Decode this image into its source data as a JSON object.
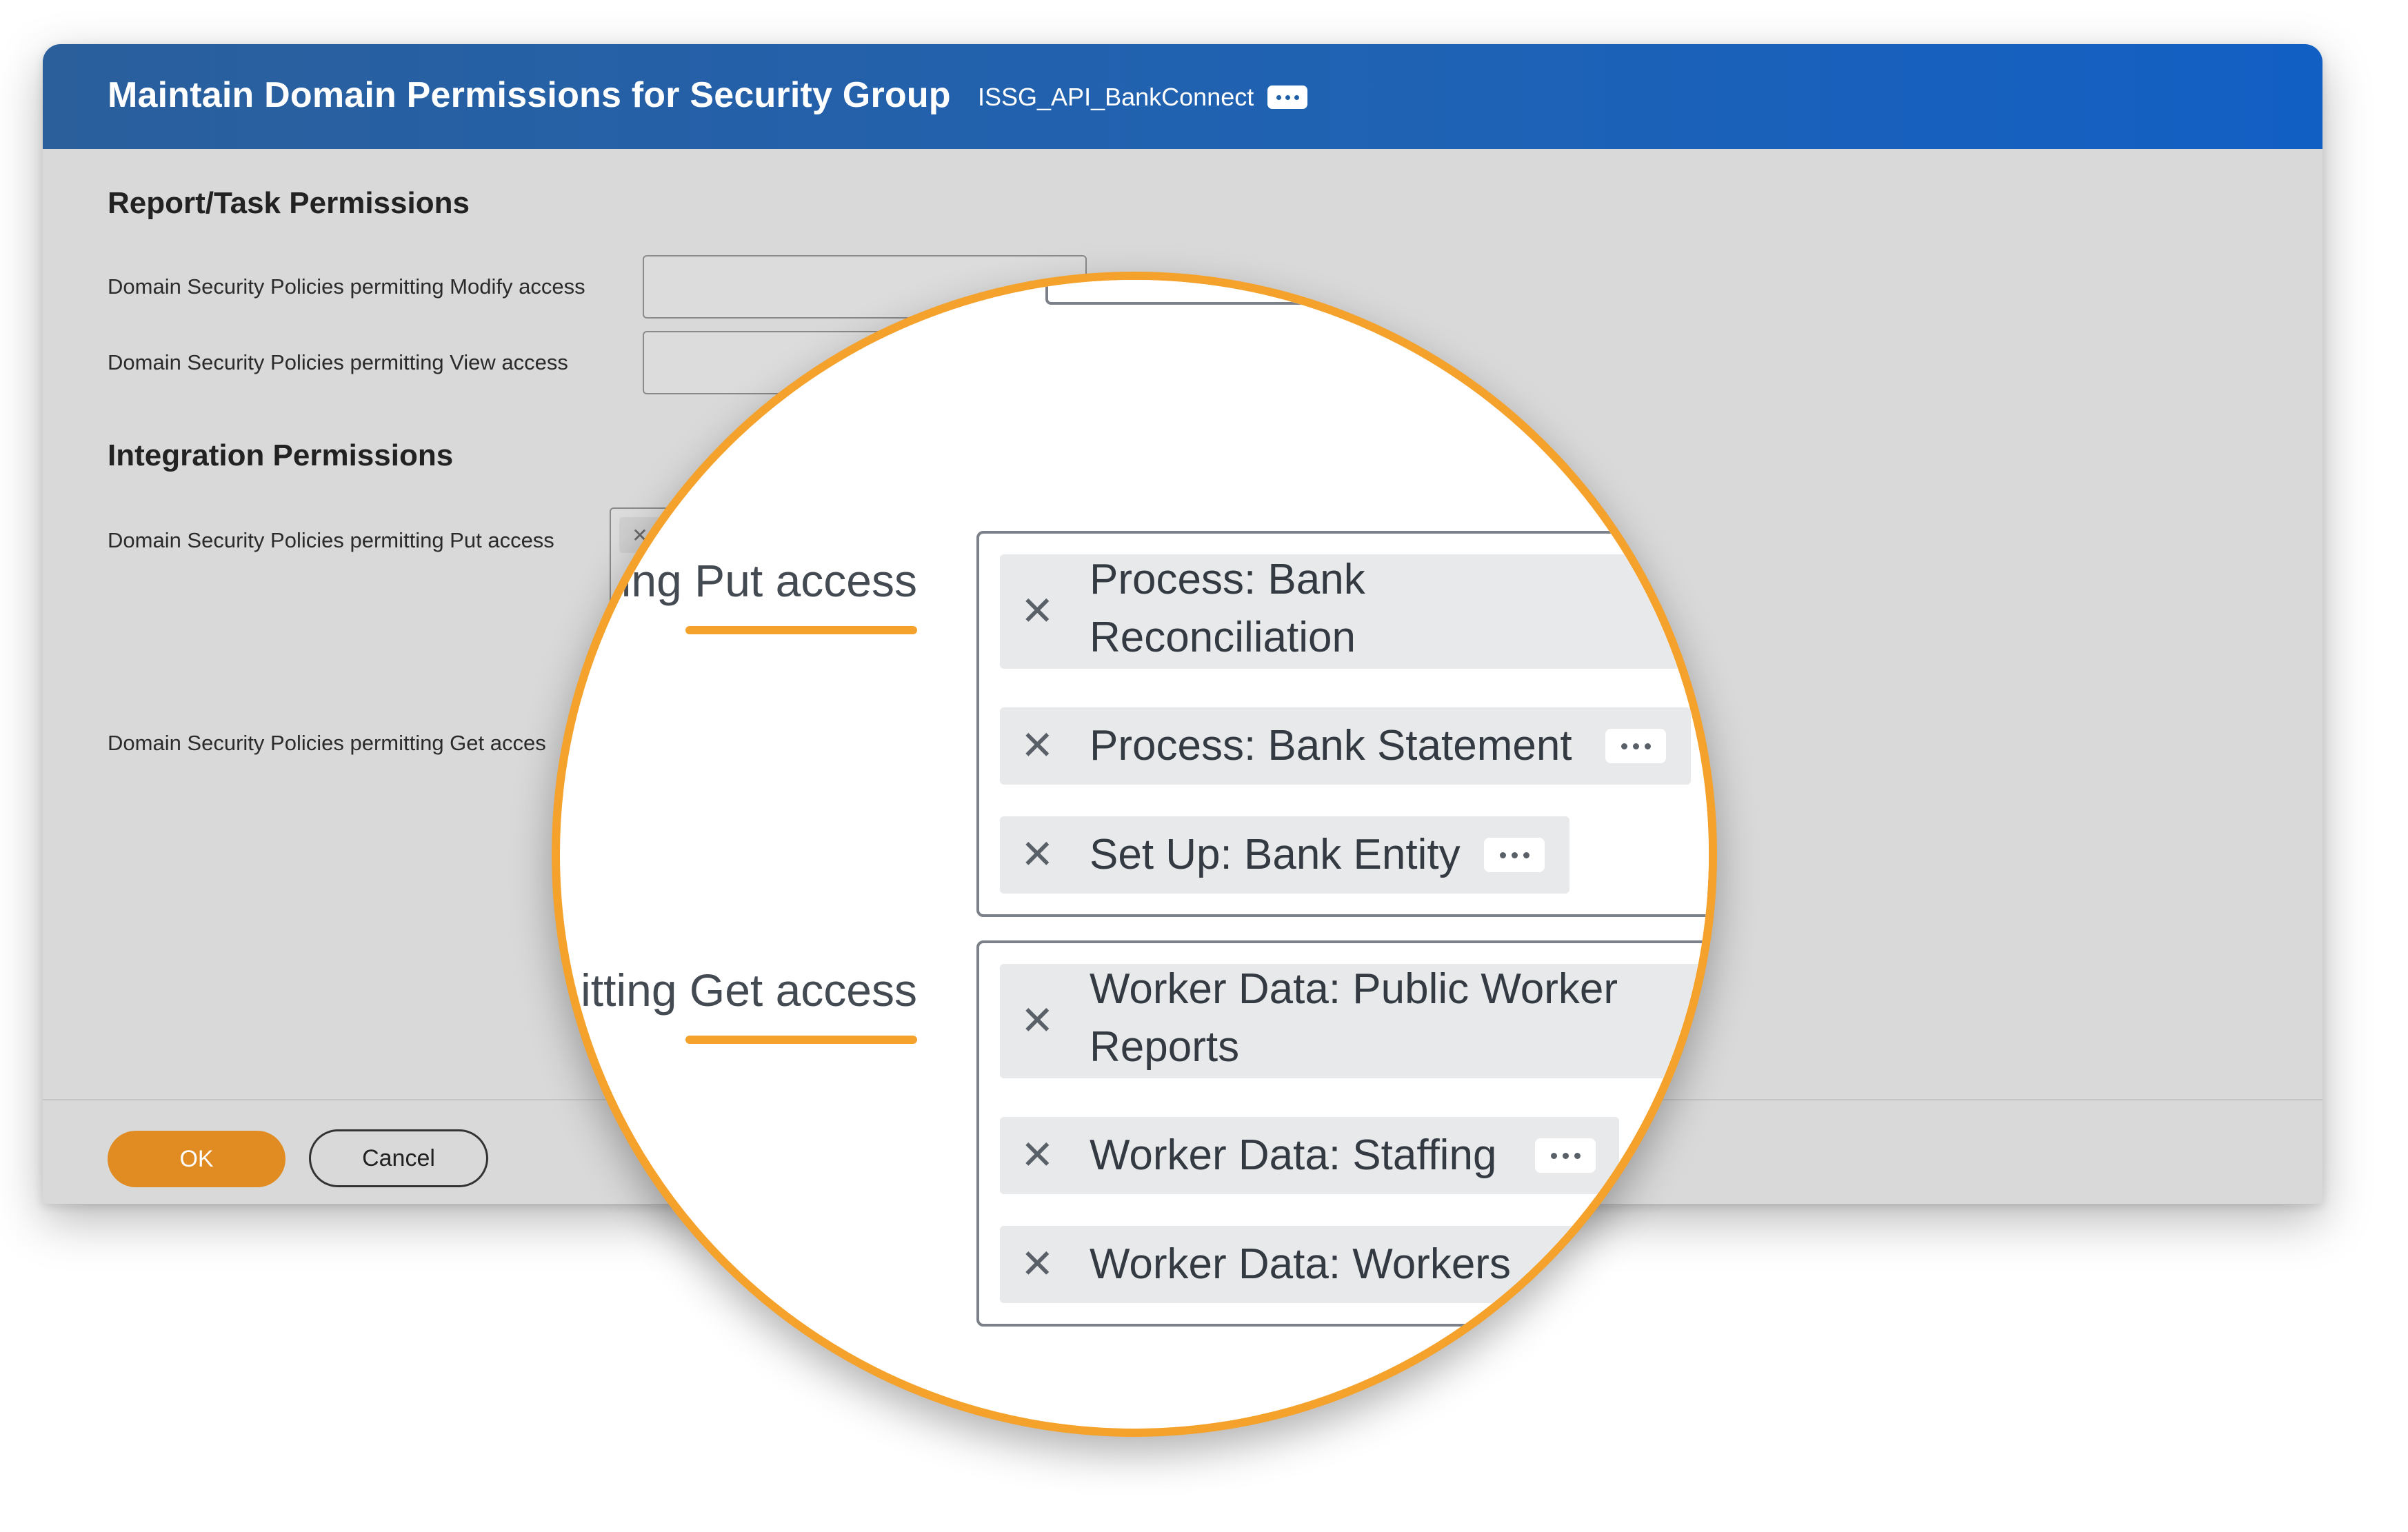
{
  "header": {
    "title": "Maintain Domain Permissions for Security Group",
    "security_group": "ISSG_API_BankConnect",
    "more_icon": "ellipsis-icon"
  },
  "sections": {
    "report_task": {
      "title": "Report/Task Permissions",
      "modify_label": "Domain Security Policies permitting Modify access",
      "view_label": "Domain Security Policies permitting View access"
    },
    "integration": {
      "title": "Integration Permissions",
      "put_label": "Domain Security Policies permitting Put access",
      "get_label": "Domain Security Policies permitting Get acces"
    }
  },
  "footer": {
    "ok_label": "OK",
    "cancel_label": "Cancel"
  },
  "magnifier": {
    "put_label": "tting Put access",
    "get_label": "itting Get access",
    "remove_glyph": "✕",
    "put_items": [
      {
        "line1": "Process: Bank",
        "line2": "Reconciliation"
      },
      {
        "line1": "Process: Bank Statement"
      },
      {
        "line1": "Set Up: Bank Entity"
      }
    ],
    "get_items": [
      {
        "line1": "Worker Data: Public Worker",
        "line2": "Reports"
      },
      {
        "line1": "Worker Data: Staffing"
      },
      {
        "line1": "Worker Data: Workers"
      }
    ]
  },
  "colors": {
    "header": "#1f62b4",
    "accent_orange": "#f5a22c",
    "ok_button": "#e18c22",
    "background": "#d9d9d9"
  }
}
